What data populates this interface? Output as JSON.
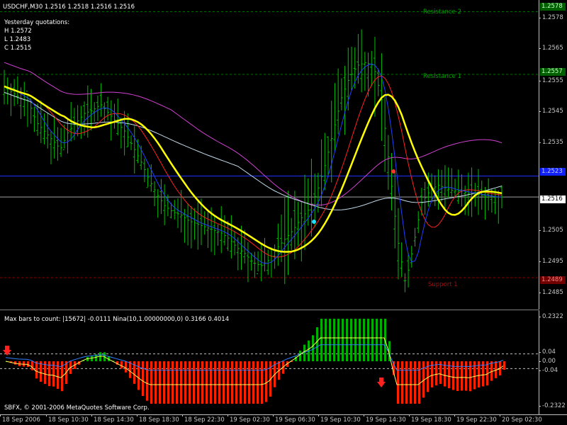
{
  "chart": {
    "header": "USDCHF,M30  1.2516 1.2518 1.2516 1.2516",
    "yesterday": {
      "title": "Yesterday quotations:",
      "high": "H 1.2572",
      "low": "L 1.2483",
      "close": "C 1.2515"
    },
    "levels": {
      "resistance2": "Resistance 2",
      "resistance1": "Resistance 1",
      "support1": "Support 1"
    },
    "indicator_header": "Max bars to count: |15672|  -0.0111  Nina(10,1.00000000,0) 0.3166 0.4014",
    "copyright": "SBFX, © 2001-2006 MetaQuotes Software Corp.",
    "price_ticks": [
      "1.2578",
      "1.2565",
      "1.2555",
      "1.2545",
      "1.2535",
      "1.2525",
      "1.2516",
      "1.2505",
      "1.2495",
      "1.2485"
    ],
    "price_tags": {
      "r2": "1.2578",
      "r1": "1.2557",
      "blue": "1.2523",
      "current": "1.2516",
      "s1": "1.2489"
    },
    "ind_ticks": [
      "0.2322",
      "0.04",
      "0.00",
      "-0.04",
      "-0.2322"
    ],
    "time_labels": [
      "18 Sep 2006",
      "18 Sep 10:30",
      "18 Sep 14:30",
      "18 Sep 18:30",
      "18 Sep 22:30",
      "19 Sep 02:30",
      "19 Sep 06:30",
      "19 Sep 10:30",
      "19 Sep 14:30",
      "19 Sep 18:30",
      "19 Sep 22:30",
      "20 Sep 02:30"
    ],
    "colors": {
      "bars": "#00c000",
      "ma_yellow": "#ffff00",
      "ma_red": "#ff2020",
      "ma_blue": "#2040ff",
      "ma_magenta": "#d040d0",
      "ma_silver": "#c0d8e8",
      "hist_red": "#ff2000",
      "hist_green": "#00b000"
    }
  },
  "chart_data": {
    "type": "candlestick",
    "symbol": "USDCHF",
    "timeframe": "M30",
    "ylim": [
      1.248,
      1.258
    ],
    "levels": {
      "Resistance 2": 1.2578,
      "Resistance 1": 1.2557,
      "Support 1": 1.2489
    },
    "close_path": [
      1.2553,
      1.2551,
      1.2549,
      1.2548,
      1.2541,
      1.2538,
      1.2535,
      1.2532,
      1.2538,
      1.2541,
      1.2544,
      1.2545,
      1.2547,
      1.2544,
      1.2541,
      1.2538,
      1.2533,
      1.2528,
      1.2522,
      1.2517,
      1.2513,
      1.2511,
      1.251,
      1.2508,
      1.2507,
      1.2506,
      1.2505,
      1.2504,
      1.2502,
      1.2499,
      1.2497,
      1.2494,
      1.2493,
      1.2495,
      1.2499,
      1.2502,
      1.2505,
      1.2509,
      1.2512,
      1.2518,
      1.2527,
      1.2538,
      1.2549,
      1.2556,
      1.256,
      1.2561,
      1.256,
      1.2549,
      1.2526,
      1.2502,
      1.2487,
      1.25,
      1.2514,
      1.2518,
      1.252,
      1.2519,
      1.2518,
      1.2518,
      1.2517,
      1.2517,
      1.2516,
      1.2516,
      1.2516
    ]
  }
}
